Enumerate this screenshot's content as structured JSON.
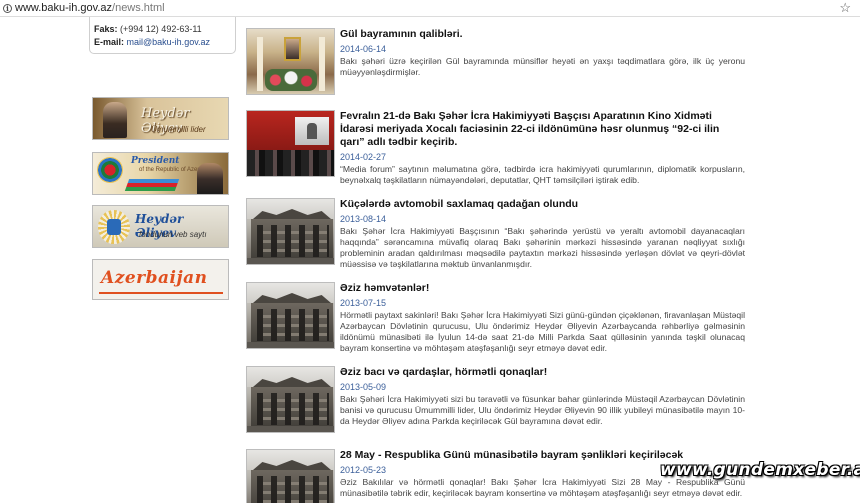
{
  "browser": {
    "url_domain": "www.baku-ih.gov.az",
    "url_path": "/news.html"
  },
  "contact": {
    "fax_label": "Faks:",
    "fax_value": "(+994 12) 492-63-11",
    "email_label": "E-mail:",
    "email_value": "mail@baku-ih.gov.az"
  },
  "banners": [
    {
      "line1": "Heydər Əliyev",
      "line2": "Ümummilli lider"
    },
    {
      "line1": "President",
      "line2": "of the Republic of Azerbaijan"
    },
    {
      "line1": "Heydər Əliyev",
      "line2": "fondunun veb saytı"
    },
    {
      "line1": "Azerbaijan"
    }
  ],
  "news": [
    {
      "title": "Gül bayramının qaliblәri.",
      "date": "2014-06-14",
      "text": "Bakı şəhəri üzrə keçirilən Gül bayramında münsiflər heyəti ən yaxşı təqdimatlara görə, ilk üç yeronu müəyyənləşdirmişlər."
    },
    {
      "title": "Fevralın 21-də Bakı Şəhər İcra Hakimiyyəti Başçısı Aparatının Kino Xidməti İdarəsi meriyada Xocalı faciəsinin 22-ci ildönümünə həsr olunmuş “92-ci ilin qarı” adlı tədbir keçirib.",
      "date": "2014-02-27",
      "text": "“Media forum” saytının məlumatına görə, tədbirdə icra hakimiyyəti qurumlarının, diplomatik korpusların, beynəlxalq təşkilatların nümayəndələri, deputatlar, QHT təmsilçiləri iştirak edib."
    },
    {
      "title": "Küçələrdə avtomobil saxlamaq qadağan olundu",
      "date": "2013-08-14",
      "text": "Bakı Şəhər İcra Hakimiyyəti Başçısının “Bakı şəhərində yerüstü və yeraltı avtomobil dayanacaqları haqqında” sərəncamına müvafiq olaraq Bakı şəhərinin mərkəzi hissəsində yaranan nəqliyyat sıxlığı probleminin aradan qaldırılması məqsədilə paytaxtın mərkəzi hissəsində yerləşən dövlət və qeyri-dövlət müəssisə və təşkilatlarına məktub ünvanlanmışdır."
    },
    {
      "title": "Əziz həmvətənlər!",
      "date": "2013-07-15",
      "text": "Hörmətli paytaxt sakinləri! Bakı Şəhər İcra Hakimiyyəti Sizi günü-gündən çiçəklənən, firavanlaşan Müstəqil Azərbaycan Dövlətinin qurucusu, Ulu öndərimiz Heydər Əliyevin Azərbaycanda rəhbərliyə gəlməsinin ildönümü münasibəti ilə İyulun 14-də saat 21-də Milli Parkda Saat qülləsinin yanında təşkil olunacaq bayram konsertinə və möhtəşəm atəşfəşanlığı seyr etməyə dəvət edir."
    },
    {
      "title": "Əziz bacı və qardaşlar, hörmətli qonaqlar!",
      "date": "2013-05-09",
      "text": "Bakı Şəhəri İcra Hakimiyyəti sizi bu təravətli və füsunkar bahar günlərində Müstəqil Azərbaycan Dövlətinin banisi və qurucusu Ümummilli lider, Ulu öndərimiz Heydər Əliyevin 90 illik yubileyi münasibətilə mayın 10-da Heydər Əliyev adına Parkda keçiriləcək Gül bayramına dəvət edir."
    },
    {
      "title": "28 May - Respublika Günü münasibətilə bayram şənlikləri keçiriləcək",
      "date": "2012-05-23",
      "text": "Əziz Bakılılar və hörmətli qonaqlar! Bakı Şəhər İcra Hakimiyyəti Sizi 28 May - Respublika Günü münasibətilə təbrik edir, keçiriləcək bayram konsertinə və möhtəşəm atəşfəşanlığı seyr etməyə dəvət edir."
    }
  ],
  "watermark": "www.gundemxeber.az"
}
